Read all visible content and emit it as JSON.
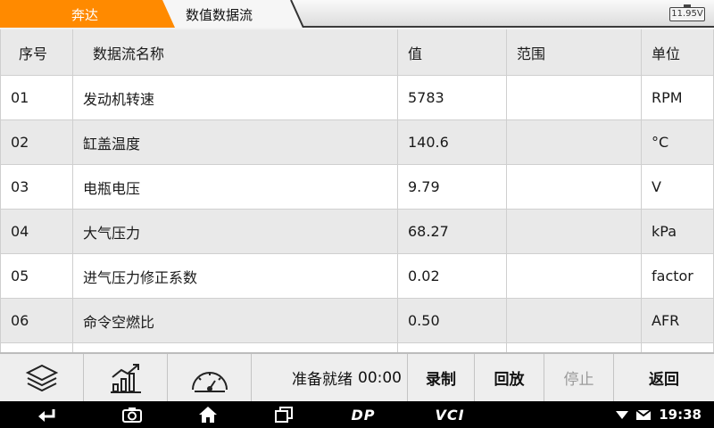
{
  "tabs": {
    "brand": "奔达",
    "current": "数值数据流"
  },
  "battery": {
    "voltage": "11.95V"
  },
  "table": {
    "headers": {
      "index": "序号",
      "name": "数据流名称",
      "value": "值",
      "range": "范围",
      "unit": "单位"
    },
    "rows": [
      {
        "index": "01",
        "name": "发动机转速",
        "value": "5783",
        "range": "",
        "unit": "RPM"
      },
      {
        "index": "02",
        "name": "缸盖温度",
        "value": "140.6",
        "range": "",
        "unit": "°C"
      },
      {
        "index": "03",
        "name": "电瓶电压",
        "value": "9.79",
        "range": "",
        "unit": "V"
      },
      {
        "index": "04",
        "name": "大气压力",
        "value": "68.27",
        "range": "",
        "unit": "kPa"
      },
      {
        "index": "05",
        "name": "进气压力修正系数",
        "value": "0.02",
        "range": "",
        "unit": "factor"
      },
      {
        "index": "06",
        "name": "命令空燃比",
        "value": "0.50",
        "range": "",
        "unit": "AFR"
      }
    ]
  },
  "toolbar": {
    "icons": [
      "layers-icon",
      "trend-chart-icon",
      "gauge-icon"
    ],
    "status_label": "准备就绪",
    "timer": "00:00",
    "record_label": "录制",
    "playback_label": "回放",
    "stop_label": "停止",
    "back_label": "返回"
  },
  "navbar": {
    "dp_label": "DP",
    "vci_label": "VCI",
    "time": "19:38"
  },
  "colors": {
    "brand_tab": "#ff8a00",
    "row_alt": "#e9e9e9",
    "header_bg": "#e9e9e9"
  }
}
